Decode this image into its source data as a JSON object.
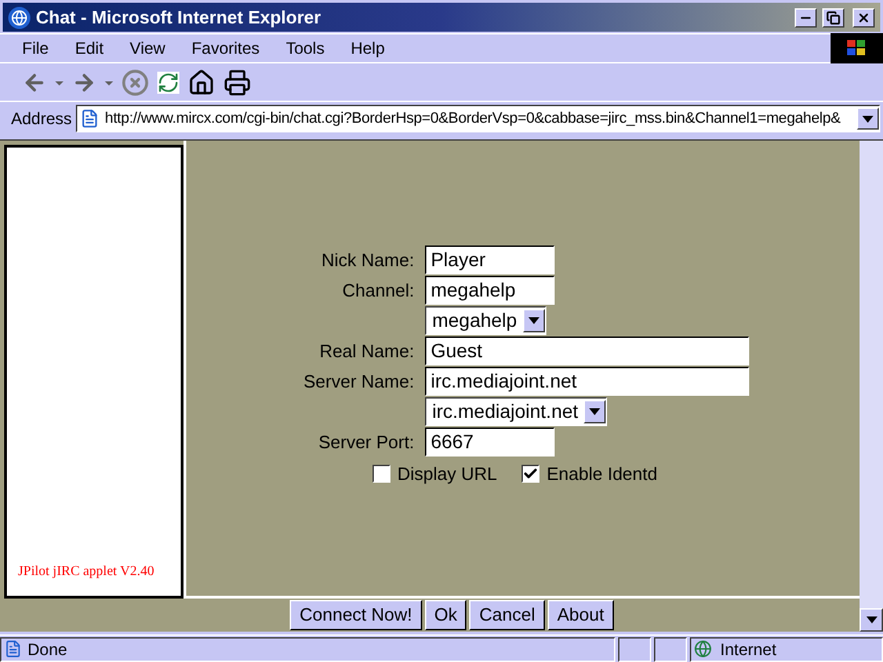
{
  "window": {
    "title": "Chat - Microsoft Internet Explorer"
  },
  "menu": [
    "File",
    "Edit",
    "View",
    "Favorites",
    "Tools",
    "Help"
  ],
  "address": {
    "label": "Address",
    "url": "http://www.mircx.com/cgi-bin/chat.cgi?BorderHsp=0&BorderVsp=0&cabbase=jirc_mss.bin&Channel1=megahelp&"
  },
  "applet": {
    "version": "JPilot jIRC applet V2.40",
    "fields": [
      {
        "kind": "text",
        "label": "Nick Name:",
        "value": "Player",
        "wide": false
      },
      {
        "kind": "text",
        "label": "Channel:",
        "value": "megahelp",
        "wide": false
      },
      {
        "kind": "select",
        "value": "megahelp"
      },
      {
        "kind": "text",
        "label": "Real Name:",
        "value": "Guest",
        "wide": true
      },
      {
        "kind": "text",
        "label": "Server Name:",
        "value": "irc.mediajoint.net",
        "wide": true
      },
      {
        "kind": "select",
        "value": "irc.mediajoint.net"
      },
      {
        "kind": "text",
        "label": "Server Port:",
        "value": "6667",
        "wide": false
      }
    ],
    "checkboxes": [
      {
        "label": "Display URL",
        "checked": false
      },
      {
        "label": "Enable Identd",
        "checked": true
      }
    ],
    "buttons": [
      "Connect Now!",
      "Ok",
      "Cancel",
      "About"
    ]
  },
  "status_bar": {
    "text": "Done",
    "zone": "Internet"
  }
}
